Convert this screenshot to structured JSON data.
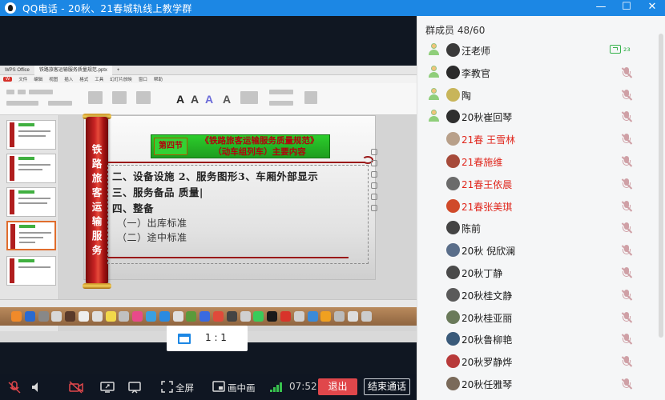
{
  "window": {
    "title": "QQ电话 - 20秋、21春城轨线上教学群",
    "controls": {
      "minimize": "—",
      "maximize": "☐",
      "close": "✕"
    }
  },
  "shared_screen": {
    "app_tabs": [
      "WPS Office",
      "铁路旅客运输服务质量规范.pptx",
      "+"
    ],
    "menu_items": [
      "文件",
      "编辑",
      "视图",
      "插入",
      "格式",
      "工具",
      "幻灯片放映",
      "窗口",
      "帮助"
    ],
    "slide": {
      "vertical_title": "铁路旅客运输服务",
      "section_no": "第四节",
      "heading_line1": "《铁路旅客运输服务质量规范》",
      "heading_line2": "（动车组列车）主要内容",
      "body": [
        "二、设备设施 2、服务图形3、车厢外部显示",
        "三、服务备品 质量|",
        "四、整备",
        "（一）出库标准",
        "（二）途中标准"
      ]
    }
  },
  "aspect_popup": {
    "ratio_label": "1 : 1"
  },
  "toolbar": {
    "fullscreen_label": "全屏",
    "pip_label": "画中画",
    "timer": "07:52",
    "leave_label": "退出",
    "end_call_label": "结束通话"
  },
  "members_panel": {
    "header": "群成员 48/60",
    "members": [
      {
        "name": "汪老师",
        "host": true,
        "status": "sharing",
        "avatar_color": "#3a3a3a"
      },
      {
        "name": "李教官",
        "host": true,
        "status": "muted",
        "avatar_color": "#2b2b2b"
      },
      {
        "name": "陶",
        "host": true,
        "status": "muted",
        "avatar_color": "#c8b55a"
      },
      {
        "name": "20秋崔回琴",
        "host": true,
        "status": "muted",
        "avatar_color": "#2f2f2f"
      },
      {
        "name": "21春 王雪林",
        "host": false,
        "status": "muted",
        "red": true,
        "avatar_color": "#b8a08a"
      },
      {
        "name": "21春施维",
        "host": false,
        "status": "muted",
        "red": true,
        "avatar_color": "#a64a3a"
      },
      {
        "name": "21春王依晨",
        "host": false,
        "status": "muted",
        "red": true,
        "avatar_color": "#6b6b6b"
      },
      {
        "name": "21春张美琪",
        "host": false,
        "status": "muted",
        "red": true,
        "avatar_color": "#d04a2a"
      },
      {
        "name": "陈前",
        "host": false,
        "status": "muted",
        "avatar_color": "#444"
      },
      {
        "name": "20秋 倪欣澜",
        "host": false,
        "status": "muted",
        "avatar_color": "#5a6e8a"
      },
      {
        "name": "20秋丁静",
        "host": false,
        "status": "muted",
        "avatar_color": "#4a4a4a"
      },
      {
        "name": "20秋桂文静",
        "host": false,
        "status": "muted",
        "avatar_color": "#5a5a5a"
      },
      {
        "name": "20秋桂亚丽",
        "host": false,
        "status": "muted",
        "avatar_color": "#6a7a5a"
      },
      {
        "name": "20秋鲁柳艳",
        "host": false,
        "status": "muted",
        "avatar_color": "#3a5a7a"
      },
      {
        "name": "20秋罗静烨",
        "host": false,
        "status": "muted",
        "avatar_color": "#b83a3a"
      },
      {
        "name": "20秋任雅琴",
        "host": false,
        "status": "muted",
        "avatar_color": "#7a6a5a"
      }
    ]
  },
  "colors": {
    "titlebar": "#1c87e4",
    "leave_button": "#e0474b",
    "red_name": "#e0261c",
    "signal": "#38c24e"
  }
}
